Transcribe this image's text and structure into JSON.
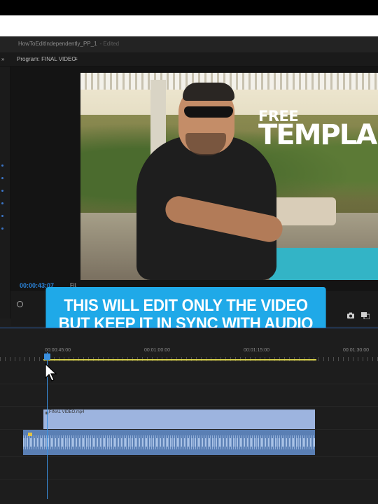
{
  "window": {
    "project_title": "HowToEditIndependently_PP_1",
    "edited_label": "- Edited"
  },
  "program_monitor": {
    "panel_title": "Program: FINAL VIDEO",
    "menu_icon": "≡",
    "collapse_icon": "»",
    "timecode": "00:00:43:07",
    "fit_label": "Fit",
    "overlay_free": "FREE",
    "overlay_template": "TEMPLA"
  },
  "caption": {
    "line1": "THIS WILL EDIT ONLY THE VIDEO",
    "line2": "BUT KEEP IT IN SYNC WITH AUDIO",
    "color": "#1fa9e8"
  },
  "timeline": {
    "ruler_ticks": [
      "00:00:45:00",
      "00:01:00:00",
      "00:01:15:00",
      "00:01:30:00"
    ],
    "video_clip_name": "FINAL VIDEO.mp4",
    "video_clip_color": "#9db4df",
    "audio_clip_color": "#5a7fb4",
    "playhead_color": "#3a90e0",
    "workarea_color": "#d6cf4a"
  },
  "icons": {
    "camera": "camera-icon",
    "export_frame": "export-frame-icon",
    "cursor": "mouse-cursor-icon"
  }
}
